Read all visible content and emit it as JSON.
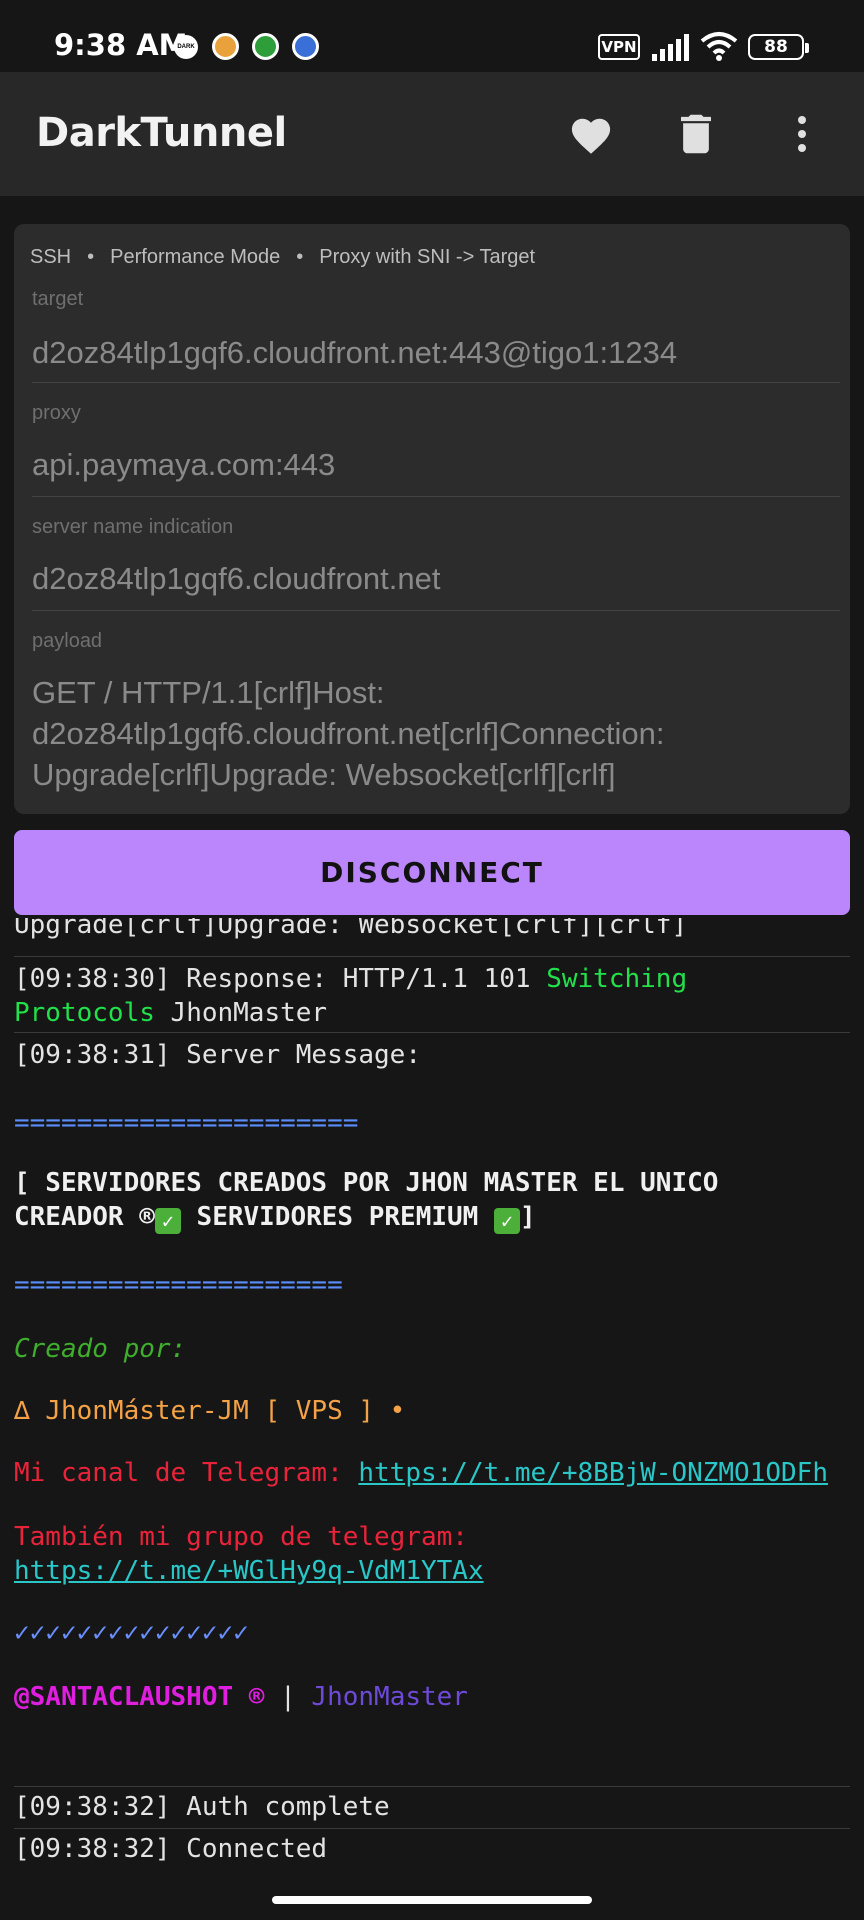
{
  "status_bar": {
    "time": "9:38 AM",
    "dark_label": "DARK",
    "vpn_label": "VPN",
    "battery": "88",
    "notification_icons": [
      "dark-mode-icon",
      "coin-icon",
      "shield-icon",
      "network-icon"
    ]
  },
  "app_bar": {
    "title": "DarkTunnel",
    "icons": [
      "heart-icon",
      "trash-icon",
      "more-vert-icon"
    ]
  },
  "config": {
    "crumbs": [
      "SSH",
      "Performance Mode",
      "Proxy with SNI -> Target"
    ],
    "fields": {
      "target": {
        "label": "target",
        "value": "d2oz84tlp1gqf6.cloudfront.net:443@tigo1:1234"
      },
      "proxy": {
        "label": "proxy",
        "value": "api.paymaya.com:443"
      },
      "sni": {
        "label": "server name indication",
        "value": "d2oz84tlp1gqf6.cloudfront.net"
      },
      "payload": {
        "label": "payload",
        "value": "GET / HTTP/1.1[crlf]Host: d2oz84tlp1gqf6.cloudfront.net[crlf]Connection: Upgrade[crlf]Upgrade: Websocket[crlf][crlf]"
      }
    }
  },
  "disconnect_label": "DISCONNECT",
  "log": {
    "partial_line": "Upgrade[crlf]Upgrade: Websocket[crlf][crlf]",
    "response": {
      "prefix": "[09:38:30] Response: HTTP/1.1 101 ",
      "status_a": "Switching",
      "status_b": "Protocols",
      "suffix": " JhonMaster"
    },
    "server_msg": "[09:38:31] Server Message:",
    "divider_1": "======================",
    "banner_1": "[ SERVIDORES CREADOS POR JHON MASTER EL UNICO",
    "banner_2a": "CREADOR ®",
    "banner_2b": " SERVIDORES PREMIUM ",
    "banner_2c": "]",
    "divider_2": "=====================",
    "created_by": "Creado por:",
    "vps_line": "∆ JhonMáster-JM [ VPS ] •",
    "telegram_label": "Mi canal de Telegram: ",
    "telegram_link": "https://t.me/+8BBjW-ONZMO1ODFh",
    "group_label": "También mi grupo de telegram:",
    "group_link": "https://t.me/+WGlHy9q-VdM1YTAx",
    "checks": "✓✓✓✓✓✓✓✓✓✓✓✓✓✓✓",
    "handle": "@SANTACLAUSHOT ®",
    "handle_sep": " | ",
    "handle_name": "JhonMaster",
    "auth": "[09:38:32] Auth complete",
    "connected": "[09:38:32] Connected"
  }
}
